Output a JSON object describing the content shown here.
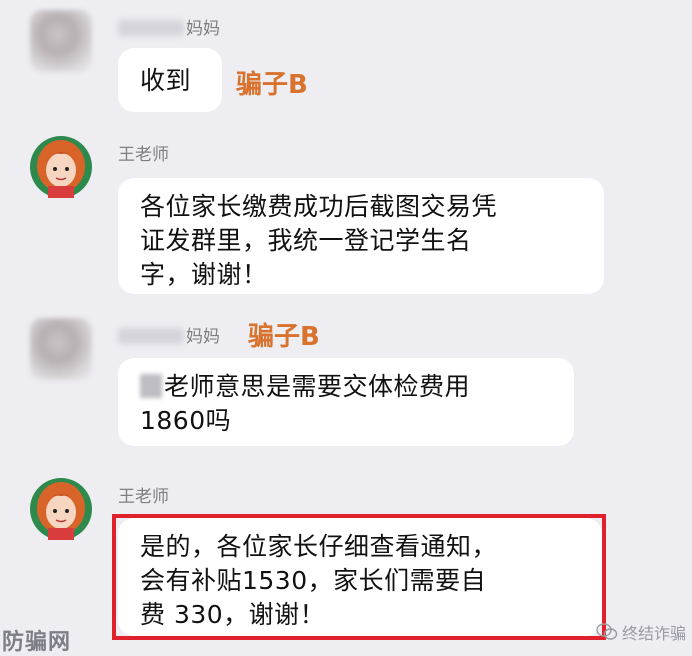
{
  "messages": [
    {
      "sender_suffix": "妈妈",
      "lines": [
        "收到"
      ],
      "tag": "骗子B"
    },
    {
      "sender": "王老师",
      "lines": [
        "各位家长缴费成功后截图交易凭",
        "证发群里，我统一登记学生名",
        "字，谢谢！"
      ]
    },
    {
      "sender_suffix": "妈妈",
      "tag": "骗子B",
      "lines": [
        "老师意思是需要交体检费用",
        "1860吗"
      ]
    },
    {
      "sender": "王老师",
      "lines": [
        "是的，各位家长仔细查看通知，",
        "会有补贴1530，家长们需要自",
        "费 330，谢谢！"
      ]
    }
  ],
  "watermark": {
    "left": "防骗网",
    "right": "终结诈骗"
  },
  "colors": {
    "background": "#ededf2",
    "bubble": "#ffffff",
    "tag": "#d8722d",
    "highlight": "#e0202a"
  }
}
